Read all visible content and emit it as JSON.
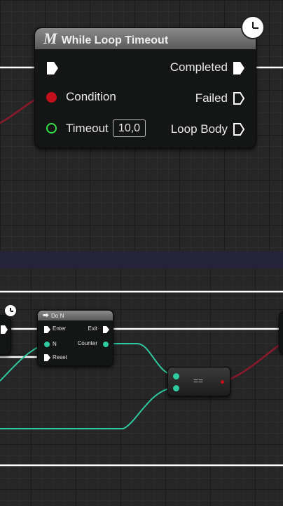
{
  "while_loop_node": {
    "title": "While Loop Timeout",
    "macro_glyph": "M",
    "inputs": {
      "condition_label": "Condition",
      "timeout_label": "Timeout",
      "timeout_value": "10,0"
    },
    "outputs": {
      "completed_label": "Completed",
      "failed_label": "Failed",
      "loop_body_label": "Loop Body"
    }
  },
  "do_n_node": {
    "title": "Do N",
    "inputs": {
      "enter_label": "Enter",
      "n_label": "N",
      "reset_label": "Reset"
    },
    "outputs": {
      "exit_label": "Exit",
      "counter_label": "Counter"
    }
  },
  "equal_node": {
    "operator": "=="
  },
  "colors": {
    "background": "#262626",
    "exec_wire": "#ffffff",
    "integer_wire": "#2ec9a0",
    "boolean_wire": "#8c1a2a",
    "boolean_pin": "#c4101b",
    "float_pin": "#35e04a",
    "divider": "#25233a"
  },
  "icons": [
    "macro-icon",
    "clock-icon",
    "exec-pin-icon",
    "data-pin-icon"
  ]
}
